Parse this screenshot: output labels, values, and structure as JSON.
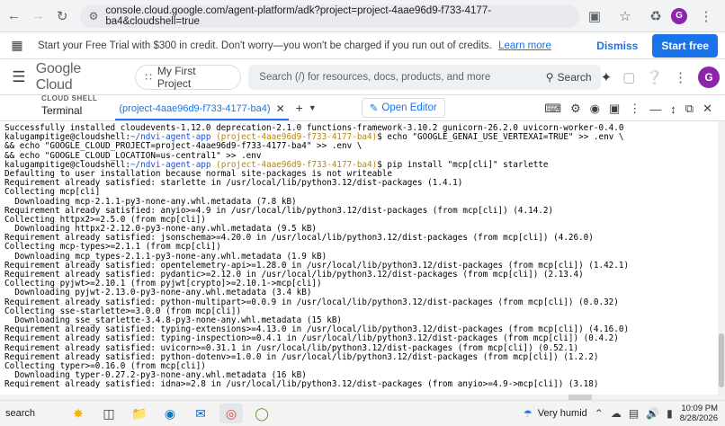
{
  "browser": {
    "url": "console.cloud.google.com/agent-platform/adk?project=project-4aae96d9-f733-4177-ba4&cloudshell=true",
    "profile_initial": "G"
  },
  "promo": {
    "message": "Start your Free Trial with $300 in credit. Don't worry—you won't be charged if you run out of credits.",
    "learn_more": "Learn more",
    "dismiss": "Dismiss",
    "start_free": "Start free"
  },
  "header": {
    "logo": "Google Cloud",
    "project": "My First Project",
    "search_placeholder": "Search (/) for resources, docs, products, and more",
    "search_button": "Search",
    "avatar_initial": "G"
  },
  "shell": {
    "label_small": "CLOUD SHELL",
    "label_big": "Terminal",
    "tab": "(project-4aae96d9-f733-4177-ba4)",
    "open_editor": "Open Editor"
  },
  "terminal": {
    "lines": [
      "Successfully installed cloudevents-1.12.0 deprecation-2.1.0 functions-framework-3.10.2 gunicorn-26.2.0 uvicorn-worker-0.4.0",
      "kalugampitige@cloudshell:~/ndvi-agent-app (project-4aae96d9-f733-4177-ba4)$ echo \"GOOGLE_GENAI_USE_VERTEXAI=TRUE\" >> .env \\",
      "&& echo \"GOOGLE_CLOUD_PROJECT=project-4aae96d9-f733-4177-ba4\" >> .env \\",
      "&& echo \"GOOGLE_CLOUD_LOCATION=us-central1\" >> .env",
      "kalugampitige@cloudshell:~/ndvi-agent-app (project-4aae96d9-f733-4177-ba4)$ pip install \"mcp[cli]\" starlette",
      "Defaulting to user installation because normal site-packages is not writeable",
      "Requirement already satisfied: starlette in /usr/local/lib/python3.12/dist-packages (1.4.1)",
      "Collecting mcp[cli]",
      "  Downloading mcp-2.1.1-py3-none-any.whl.metadata (7.8 kB)",
      "Requirement already satisfied: anyio>=4.9 in /usr/local/lib/python3.12/dist-packages (from mcp[cli]) (4.14.2)",
      "Collecting httpx2>=2.5.0 (from mcp[cli])",
      "  Downloading httpx2-2.12.0-py3-none-any.whl.metadata (9.5 kB)",
      "Requirement already satisfied: jsonschema>=4.20.0 in /usr/local/lib/python3.12/dist-packages (from mcp[cli]) (4.26.0)",
      "Collecting mcp-types>=2.1.1 (from mcp[cli])",
      "  Downloading mcp_types-2.1.1-py3-none-any.whl.metadata (1.9 kB)",
      "Requirement already satisfied: opentelemetry-api>=1.28.0 in /usr/local/lib/python3.12/dist-packages (from mcp[cli]) (1.42.1)",
      "Requirement already satisfied: pydantic>=2.12.0 in /usr/local/lib/python3.12/dist-packages (from mcp[cli]) (2.13.4)",
      "Collecting pyjwt>=2.10.1 (from pyjwt[crypto]>=2.10.1->mcp[cli])",
      "  Downloading pyjwt-2.13.0-py3-none-any.whl.metadata (3.4 kB)",
      "Requirement already satisfied: python-multipart>=0.0.9 in /usr/local/lib/python3.12/dist-packages (from mcp[cli]) (0.0.32)",
      "Collecting sse-starlette>=3.0.0 (from mcp[cli])",
      "  Downloading sse_starlette-3.4.8-py3-none-any.whl.metadata (15 kB)",
      "Requirement already satisfied: typing-extensions>=4.13.0 in /usr/local/lib/python3.12/dist-packages (from mcp[cli]) (4.16.0)",
      "Requirement already satisfied: typing-inspection>=0.4.1 in /usr/local/lib/python3.12/dist-packages (from mcp[cli]) (0.4.2)",
      "Requirement already satisfied: uvicorn>=0.31.1 in /usr/local/lib/python3.12/dist-packages (from mcp[cli]) (0.52.1)",
      "Requirement already satisfied: python-dotenv>=1.0.0 in /usr/local/lib/python3.12/dist-packages (from mcp[cli]) (1.2.2)",
      "Collecting typer>=0.16.0 (from mcp[cli])",
      "  Downloading typer-0.27.2-py3-none-any.whl.metadata (16 kB)",
      "Requirement already satisfied: idna>=2.8 in /usr/local/lib/python3.12/dist-packages (from anyio>=4.9->mcp[cli]) (3.18)"
    ]
  },
  "taskbar": {
    "search_label": "search",
    "weather": "Very humid",
    "time": "10:09 PM",
    "date": "8/28/2026"
  },
  "colors": {
    "accent": "#1a73e8",
    "avatar": "#8e24aa"
  }
}
